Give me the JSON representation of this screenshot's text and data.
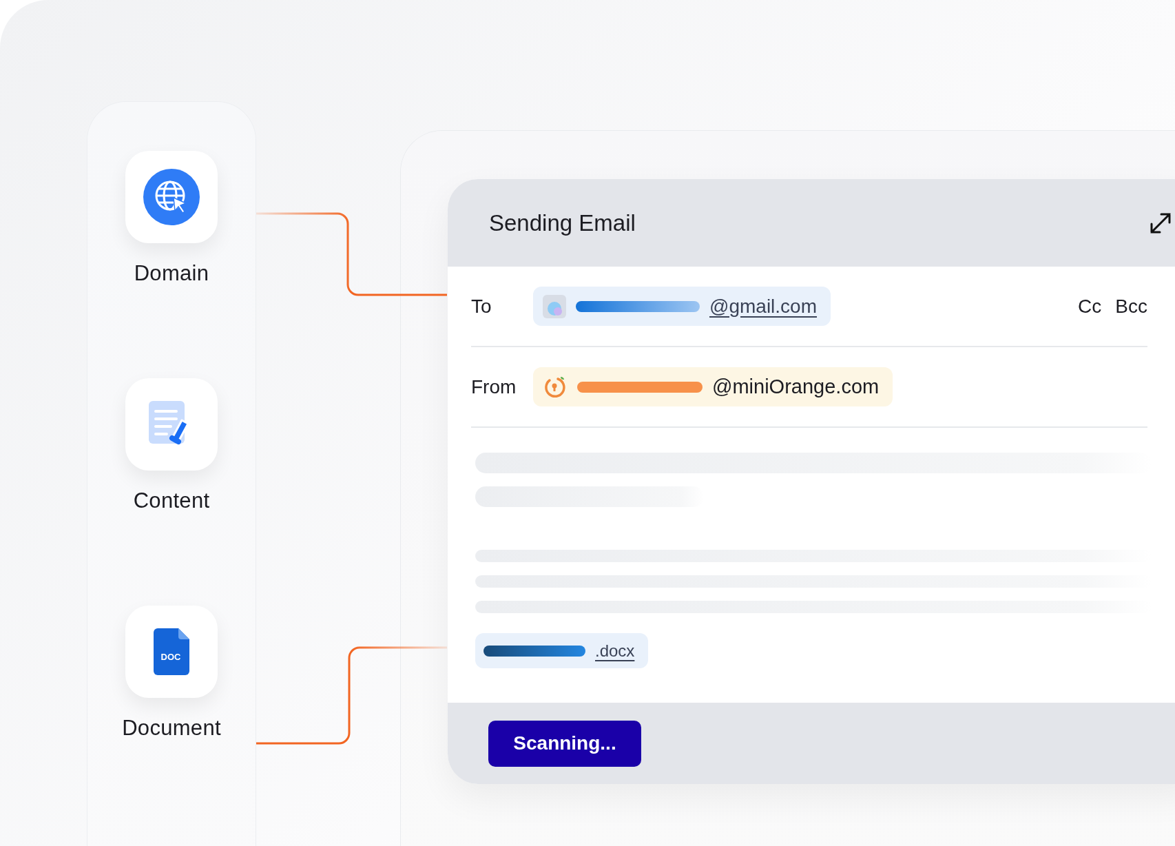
{
  "sidebar": {
    "items": [
      {
        "kind": "domain",
        "label": "Domain"
      },
      {
        "kind": "content",
        "label": "Content"
      },
      {
        "kind": "document",
        "label": "Document",
        "icon_text": "DOC"
      }
    ]
  },
  "email": {
    "title": "Sending Email",
    "to": {
      "label": "To",
      "address": "@gmail.com",
      "cc": "Cc",
      "bcc": "Bcc"
    },
    "from": {
      "label": "From",
      "address": "@miniOrange.com"
    },
    "attachment": {
      "extension": ".docx"
    },
    "button": "Scanning..."
  }
}
